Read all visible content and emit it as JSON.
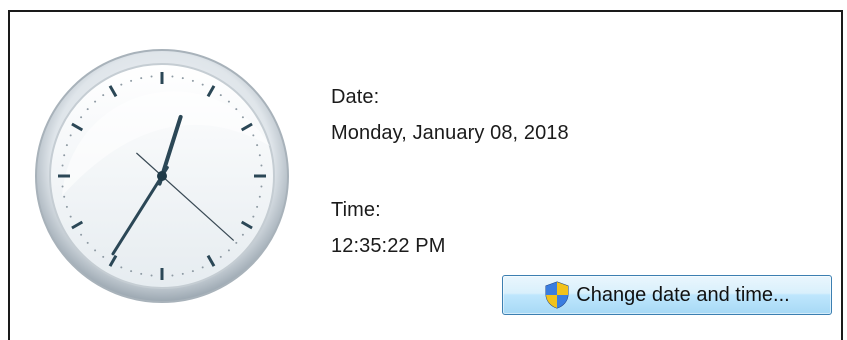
{
  "date": {
    "label": "Date:",
    "value": "Monday, January 08, 2018"
  },
  "time": {
    "label": "Time:",
    "value": "12:35:22 PM",
    "hours": 12,
    "minutes": 35,
    "seconds": 22
  },
  "change_button": {
    "label": "Change date and time...",
    "icon": "uac-shield-icon"
  },
  "colors": {
    "hand": "#2b4756",
    "second_hand": "#3a4a55",
    "face": "#f4f7f9",
    "rim": "#b9c3cb",
    "button_border": "#3c7fb1"
  }
}
